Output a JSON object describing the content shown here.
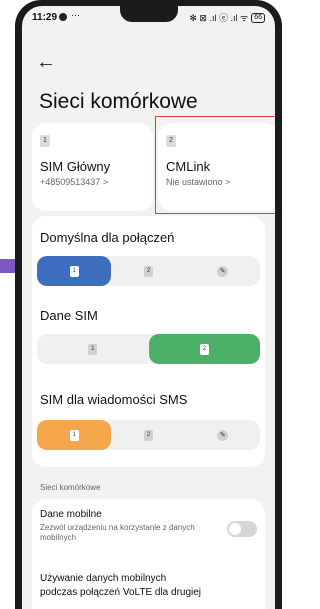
{
  "status_bar": {
    "time": "11:29",
    "more": "···",
    "icons": "✻ ⊠ .ıl ⓔ .ıl ᯤ",
    "battery": "66"
  },
  "header": {
    "back_icon": "arrow-left-icon",
    "title": "Sieci komórkowe"
  },
  "sim_cards": [
    {
      "badge": "1",
      "name": "SIM Główny",
      "subtitle": "+48509513437 >"
    },
    {
      "badge": "2",
      "name": "CMLink",
      "subtitle": "Nie ustawiono >"
    }
  ],
  "default_calls": {
    "label": "Domyślna dla połączeń",
    "options": [
      {
        "text": "1",
        "selected": true
      },
      {
        "text": "2",
        "selected": false
      }
    ],
    "edit_icon": "pencil-icon",
    "selected_color": "#3f6ec0"
  },
  "mobile_data_sim": {
    "label": "Dane SIM",
    "options": [
      {
        "text": "1",
        "selected": false
      },
      {
        "text": "2",
        "selected": true
      }
    ],
    "selected_color": "#4caf67"
  },
  "sms_sim": {
    "label": "SIM dla wiadomości SMS",
    "options": [
      {
        "text": "1",
        "selected": true
      },
      {
        "text": "2",
        "selected": false
      }
    ],
    "edit_icon": "pencil-icon",
    "selected_color": "#f5a54a"
  },
  "cellular_section": {
    "header": "Sieci komórkowe",
    "mobile_data": {
      "title": "Dane mobilne",
      "description": "Zezwól urządzeniu na korzystanie z danych mobilnych",
      "enabled": false
    },
    "volte_data": {
      "title_line1": "Używanie danych mobilnych",
      "title_line2": "podczas połączeń VoLTE dla drugiej"
    }
  },
  "highlight_color": "#e53935"
}
